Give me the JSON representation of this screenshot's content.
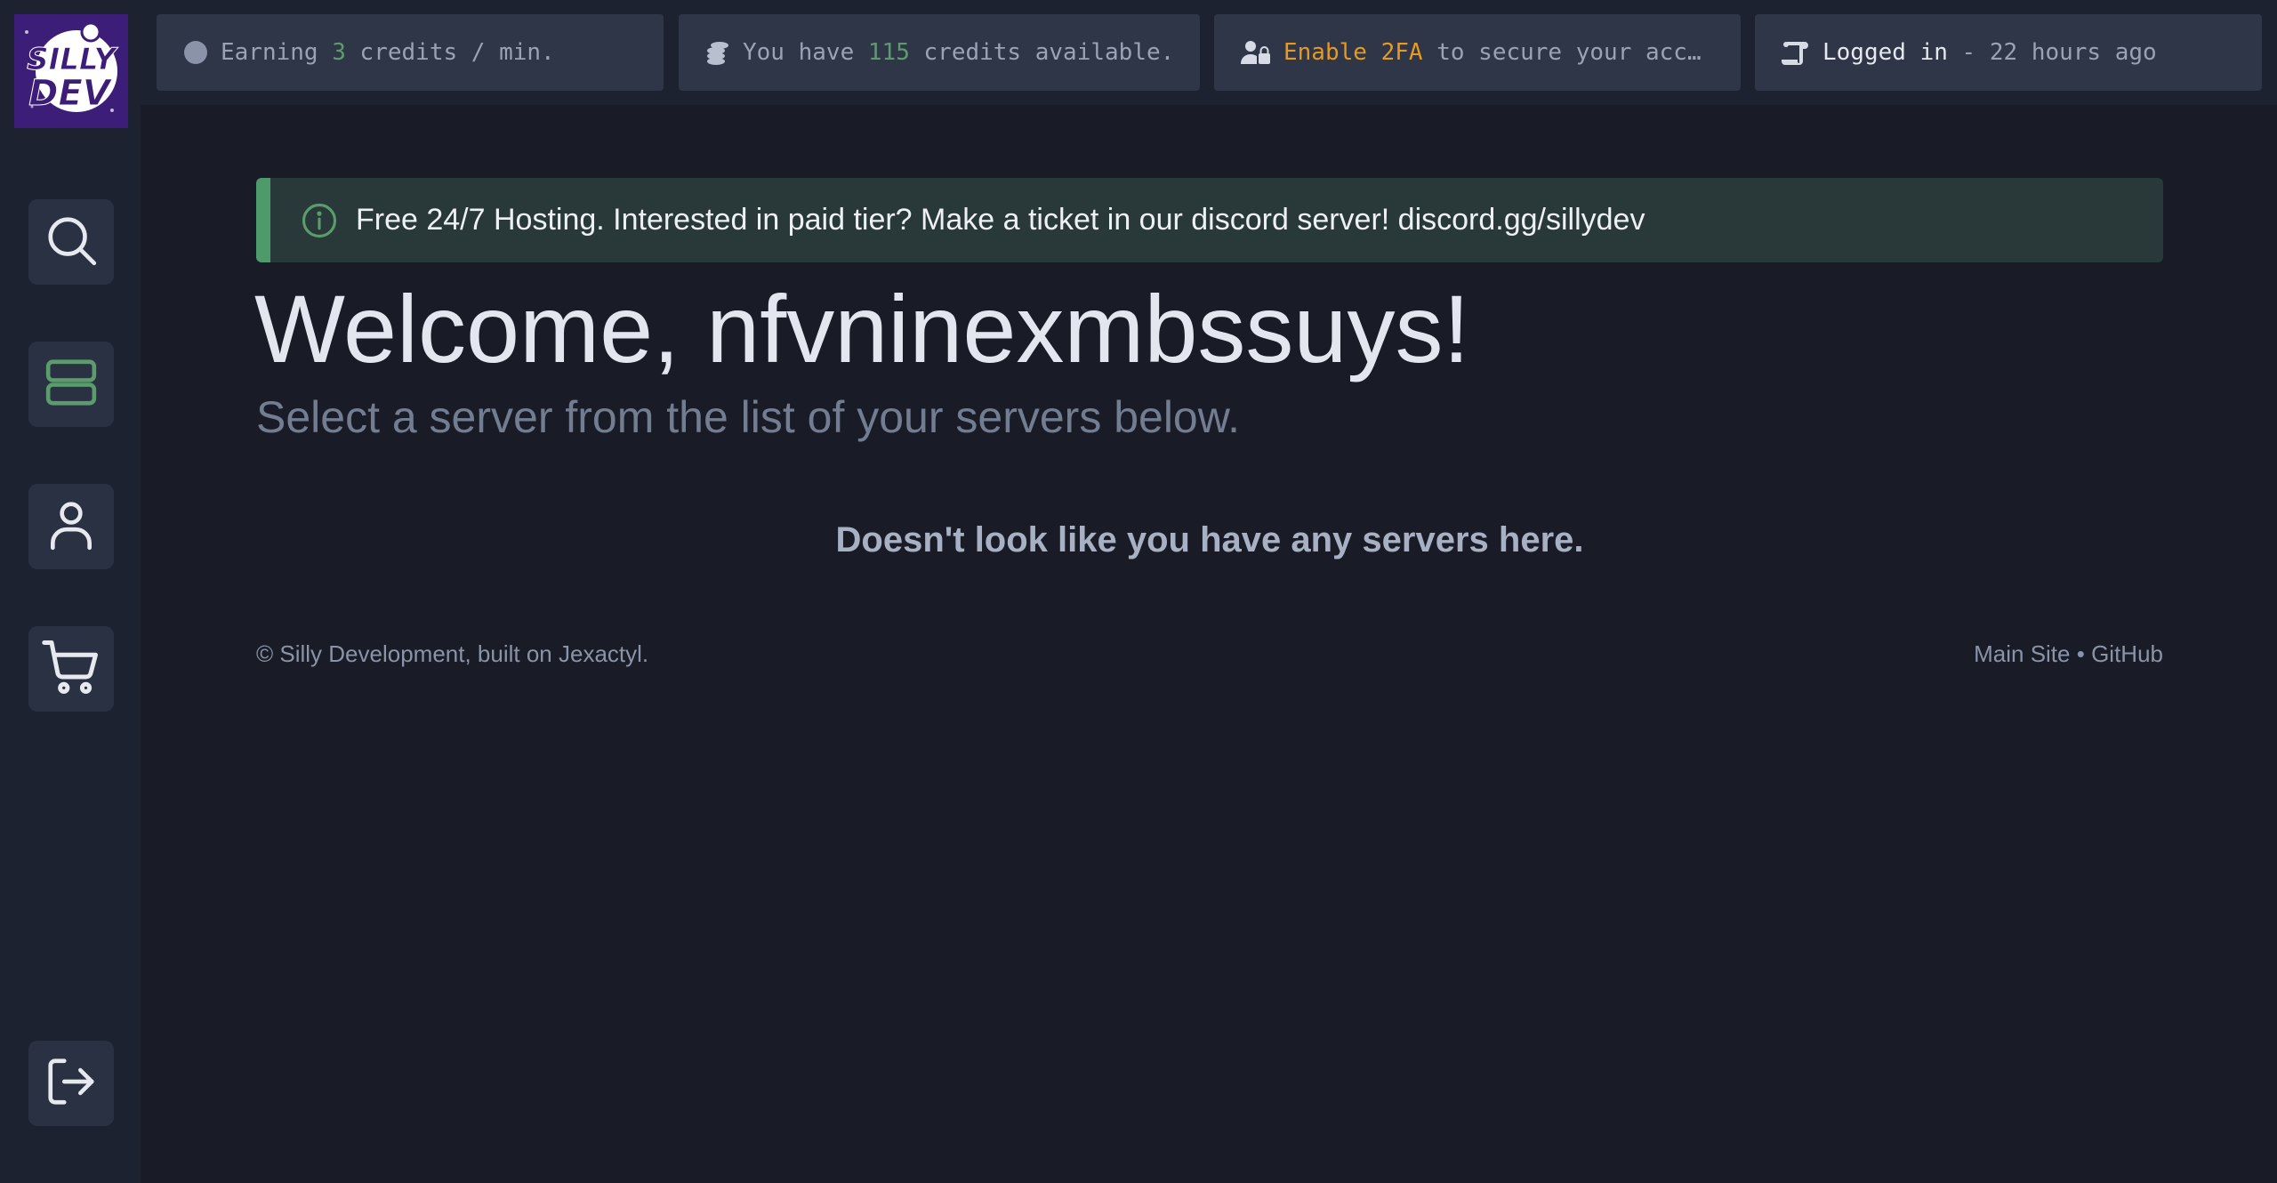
{
  "logo": {
    "line1": "SILLY",
    "line2": "DEV"
  },
  "sidebar": {
    "items": [
      {
        "name": "search",
        "icon": "search-icon"
      },
      {
        "name": "servers",
        "icon": "server-icon"
      },
      {
        "name": "account",
        "icon": "user-icon"
      },
      {
        "name": "store",
        "icon": "cart-icon"
      }
    ],
    "logout": {
      "icon": "logout-icon"
    }
  },
  "topbar": {
    "earning": {
      "prefix": "Earning",
      "value": "3",
      "suffix": "credits / min."
    },
    "credits": {
      "prefix": "You have",
      "value": "115",
      "suffix": "credits available."
    },
    "twofa": {
      "highlight": "Enable 2FA",
      "suffix": "to secure your acc…"
    },
    "login": {
      "prefix": "Logged in",
      "suffix": "- 22 hours ago"
    }
  },
  "alert": {
    "text": "Free 24/7 Hosting. Interested in paid tier? Make a ticket in our discord server! discord.gg/sillydev"
  },
  "main": {
    "welcome": "Welcome, nfvninexmbssuys!",
    "subtitle": "Select a server from the list of your servers below.",
    "empty": "Doesn't look like you have any servers here."
  },
  "footer": {
    "copyright": "© Silly Development, built on Jexactyl.",
    "main_site": "Main Site",
    "separator": "•",
    "github": "GitHub"
  },
  "colors": {
    "accent_green": "#5b9b6c",
    "warning_orange": "#e79a1f",
    "background": "#191c26",
    "panel": "#1d2230"
  }
}
